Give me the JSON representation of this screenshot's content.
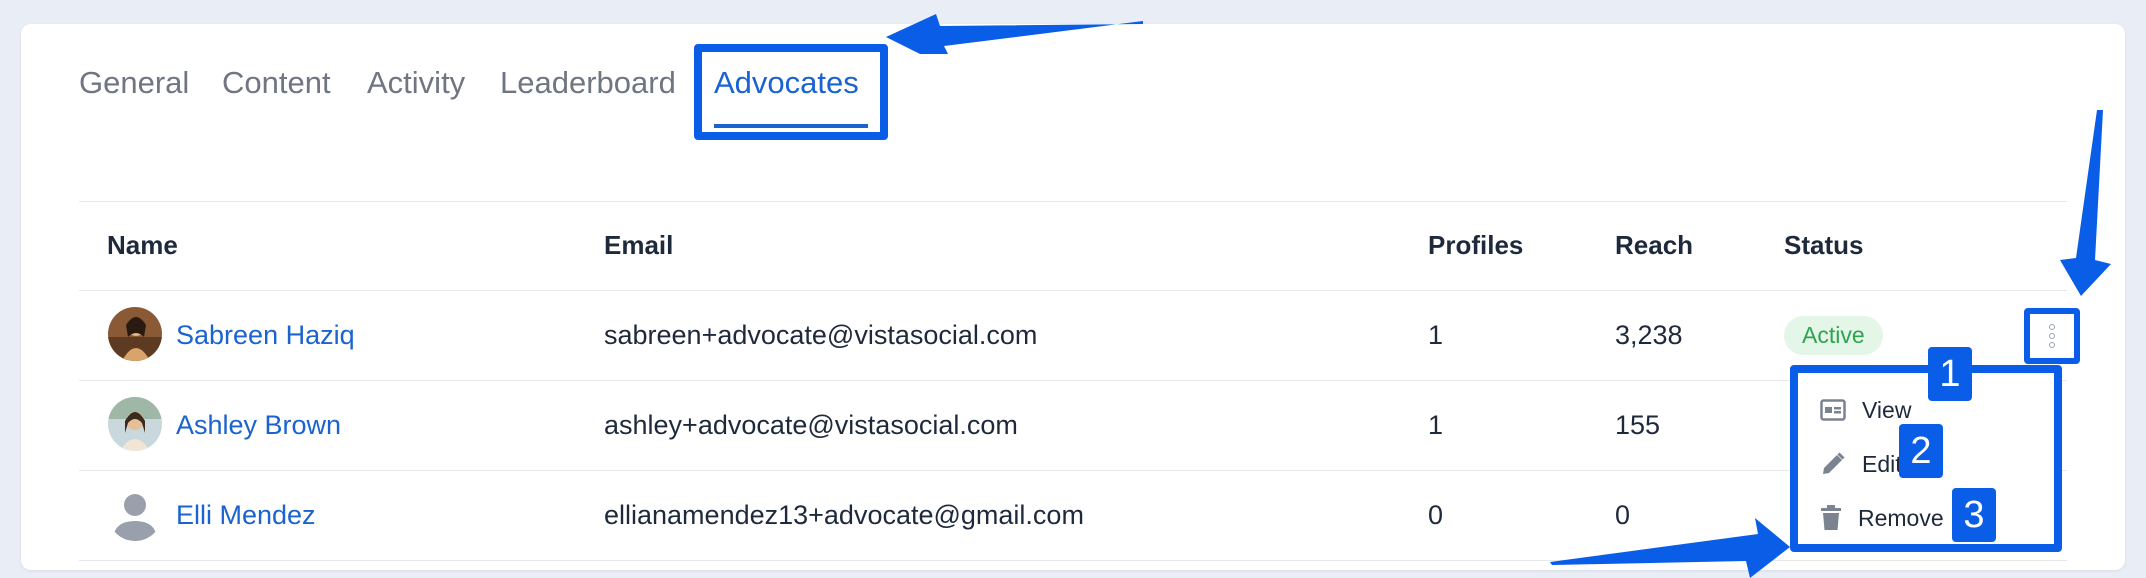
{
  "tabs": [
    {
      "label": "General"
    },
    {
      "label": "Content"
    },
    {
      "label": "Activity"
    },
    {
      "label": "Leaderboard"
    },
    {
      "label": "Advocates",
      "active": true
    }
  ],
  "table": {
    "headers": [
      "Name",
      "Email",
      "Profiles",
      "Reach",
      "Status"
    ],
    "rows": [
      {
        "name": "Sabreen Haziq",
        "email": "sabreen+advocate@vistasocial.com",
        "profiles": "1",
        "reach": "3,238",
        "status": "Active",
        "avatar": "photo"
      },
      {
        "name": "Ashley Brown",
        "email": "ashley+advocate@vistasocial.com",
        "profiles": "1",
        "reach": "155",
        "status": "",
        "avatar": "photo"
      },
      {
        "name": "Elli Mendez",
        "email": "ellianamendez13+advocate@gmail.com",
        "profiles": "0",
        "reach": "0",
        "status": "",
        "avatar": "placeholder-user-icon"
      }
    ]
  },
  "menu": {
    "items": [
      {
        "label": "View",
        "icon": "view-card-icon"
      },
      {
        "label": "Edit",
        "icon": "pencil-icon"
      },
      {
        "label": "Remove",
        "icon": "trash-icon"
      }
    ]
  },
  "annotations": {
    "badges": [
      "1",
      "2",
      "3"
    ]
  },
  "colors": {
    "accent": "#1a63d1",
    "annotation": "#0a5de6",
    "status_active_bg": "#e3f6e8",
    "status_active_text": "#2ea44f"
  }
}
